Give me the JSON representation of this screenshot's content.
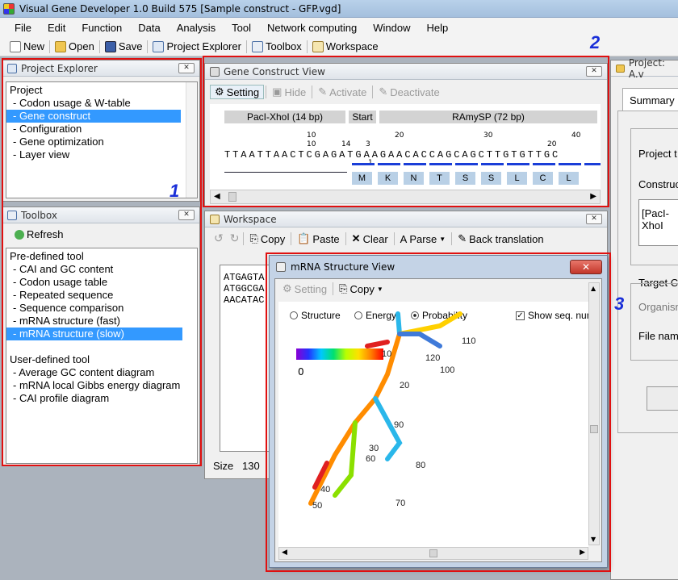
{
  "window": {
    "title": "Visual Gene Developer 1.0 Build 575   [Sample construct - GFP.vgd]"
  },
  "menu": [
    "File",
    "Edit",
    "Function",
    "Data",
    "Analysis",
    "Tool",
    "Network computing",
    "Window",
    "Help"
  ],
  "toolbar": {
    "new": "New",
    "open": "Open",
    "save": "Save",
    "project_explorer": "Project Explorer",
    "toolbox": "Toolbox",
    "workspace": "Workspace"
  },
  "project_explorer": {
    "title": "Project Explorer",
    "items": [
      "Project",
      "- Codon usage & W-table",
      "- Gene construct",
      "- Configuration",
      "- Gene optimization",
      "- Layer view"
    ],
    "selected": 2
  },
  "toolbox": {
    "title": "Toolbox",
    "refresh": "Refresh",
    "items": [
      "Pre-defined tool",
      "- CAI and GC content",
      "- Codon usage table",
      "- Repeated sequence",
      "- Sequence comparison",
      "- mRNA structure (fast)",
      "- mRNA structure (slow)",
      "",
      "User-defined tool",
      "- Average GC content diagram",
      "- mRNA local Gibbs energy diagram",
      "- CAI profile diagram"
    ],
    "selected": 6
  },
  "gene_construct": {
    "title": "Gene Construct View",
    "buttons": {
      "setting": "Setting",
      "hide": "Hide",
      "activate": "Activate",
      "deactivate": "Deactivate"
    },
    "segments": [
      "PacI-XhoI (14 bp)",
      "Start",
      "RAmySP (72 bp)"
    ],
    "numbers_row1": [
      "10",
      "20",
      "30",
      "40"
    ],
    "numbers_row2": [
      "10",
      "14",
      "3",
      "20"
    ],
    "numbers_row3": [
      "1"
    ],
    "sequence": "TTAATTAACTCGAGATGAAGAACACCAGCAGCTTGTGTTGC",
    "amino_acids": [
      "M",
      "K",
      "N",
      "T",
      "S",
      "S",
      "L",
      "C",
      "L"
    ]
  },
  "workspace": {
    "title": "Workspace",
    "buttons": {
      "copy": "Copy",
      "paste": "Paste",
      "clear": "Clear",
      "parse": "Parse",
      "back_translation": "Back translation"
    },
    "lines": [
      "ATGAGTA",
      "ATGGCGA",
      "AACATAC"
    ],
    "size_label": "Size",
    "size_value": "130"
  },
  "right_panel": {
    "title": "Project: A.v",
    "tab": "Summary",
    "labels": [
      "Project t",
      "Construct",
      "[PacI-XhoI",
      "Target C",
      "Organism",
      "File nam"
    ]
  },
  "mrna": {
    "title": "mRNA Structure View",
    "setting": "Setting",
    "copy": "Copy",
    "radios": [
      "Structure",
      "Energy",
      "Probability"
    ],
    "selected_radio": 2,
    "checkbox": "Show seq. numbe",
    "checked": true,
    "scale_min": "0",
    "labels": [
      "10",
      "20",
      "30",
      "40",
      "50",
      "60",
      "70",
      "80",
      "90",
      "100",
      "110",
      "120"
    ]
  },
  "markers": [
    "1",
    "2",
    "3"
  ]
}
